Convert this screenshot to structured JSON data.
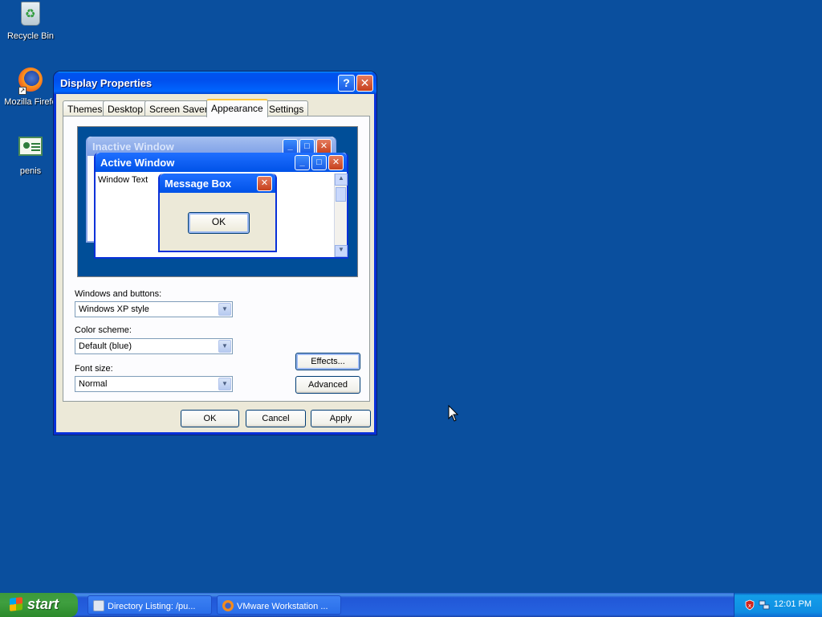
{
  "desktop": {
    "icons": [
      {
        "label": "Recycle Bin"
      },
      {
        "label": "Mozilla Firefo"
      },
      {
        "label": "penis"
      }
    ]
  },
  "window": {
    "title": "Display Properties",
    "help_glyph": "?",
    "close_glyph": "✕",
    "tabs": [
      "Themes",
      "Desktop",
      "Screen Saver",
      "Appearance",
      "Settings"
    ],
    "active_tab": "Appearance",
    "preview": {
      "inactive_title": "Inactive Window",
      "active_title": "Active Window",
      "window_text": "Window Text",
      "message_title": "Message Box",
      "message_ok": "OK"
    },
    "fields": {
      "windows_buttons_label": "Windows and buttons:",
      "windows_buttons_value": "Windows XP style",
      "color_scheme_label": "Color scheme:",
      "color_scheme_value": "Default (blue)",
      "font_size_label": "Font size:",
      "font_size_value": "Normal"
    },
    "buttons": {
      "effects": "Effects...",
      "advanced": "Advanced",
      "ok": "OK",
      "cancel": "Cancel",
      "apply": "Apply"
    }
  },
  "taskbar": {
    "start": "start",
    "items": [
      {
        "label": "Directory Listing: /pu..."
      },
      {
        "label": "VMware Workstation ..."
      }
    ],
    "clock": "12:01 PM"
  },
  "colors": {
    "desktop": "#0a4f9e",
    "title_blue": "#0053ee",
    "start_green": "#3c9a3c"
  }
}
